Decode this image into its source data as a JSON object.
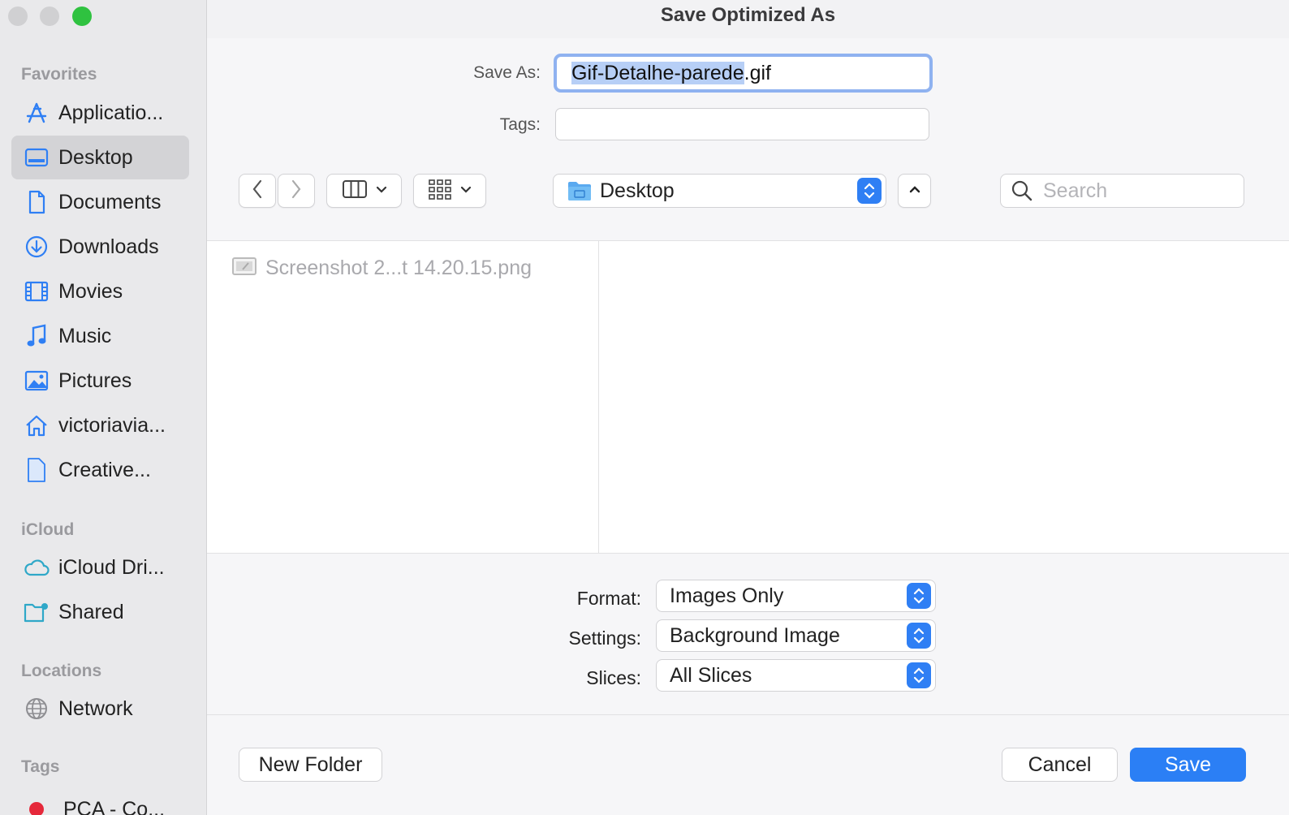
{
  "window": {
    "title": "Save Optimized As"
  },
  "sidebar": {
    "sections": {
      "favorites": "Favorites",
      "icloud": "iCloud",
      "locations": "Locations",
      "tags": "Tags"
    },
    "favorites": [
      {
        "label": "Applicatio...",
        "icon": "applications-icon"
      },
      {
        "label": "Desktop",
        "icon": "desktop-icon",
        "selected": true
      },
      {
        "label": "Documents",
        "icon": "document-icon"
      },
      {
        "label": "Downloads",
        "icon": "downloads-icon"
      },
      {
        "label": "Movies",
        "icon": "film-icon"
      },
      {
        "label": "Music",
        "icon": "music-note-icon"
      },
      {
        "label": "Pictures",
        "icon": "photo-icon"
      },
      {
        "label": "victoriavia...",
        "icon": "home-icon"
      },
      {
        "label": "Creative...",
        "icon": "file-icon"
      }
    ],
    "icloud": [
      {
        "label": "iCloud Dri...",
        "icon": "cloud-icon"
      },
      {
        "label": "Shared",
        "icon": "shared-folder-icon"
      }
    ],
    "locations": [
      {
        "label": "Network",
        "icon": "globe-icon"
      }
    ],
    "tags": [
      {
        "label": "PCA - Co...",
        "color": "#e5283a"
      }
    ]
  },
  "form": {
    "save_as_label": "Save As:",
    "save_as_selected": "Gif-Detalhe-parede",
    "save_as_extension": ".gif",
    "tags_label": "Tags:",
    "tags_value": ""
  },
  "toolbar": {
    "location": "Desktop",
    "search_placeholder": "Search"
  },
  "browser": {
    "files": [
      {
        "name": "Screenshot 2...t 14.20.15.png",
        "dimmed": true
      }
    ]
  },
  "options": {
    "format_label": "Format:",
    "format_value": "Images Only",
    "settings_label": "Settings:",
    "settings_value": "Background Image",
    "slices_label": "Slices:",
    "slices_value": "All Slices"
  },
  "buttons": {
    "new_folder": "New Folder",
    "cancel": "Cancel",
    "save": "Save"
  },
  "colors": {
    "accent": "#2b7ff5",
    "sidebar_icon": "#2f7ff4",
    "tag_red": "#e5283a"
  }
}
